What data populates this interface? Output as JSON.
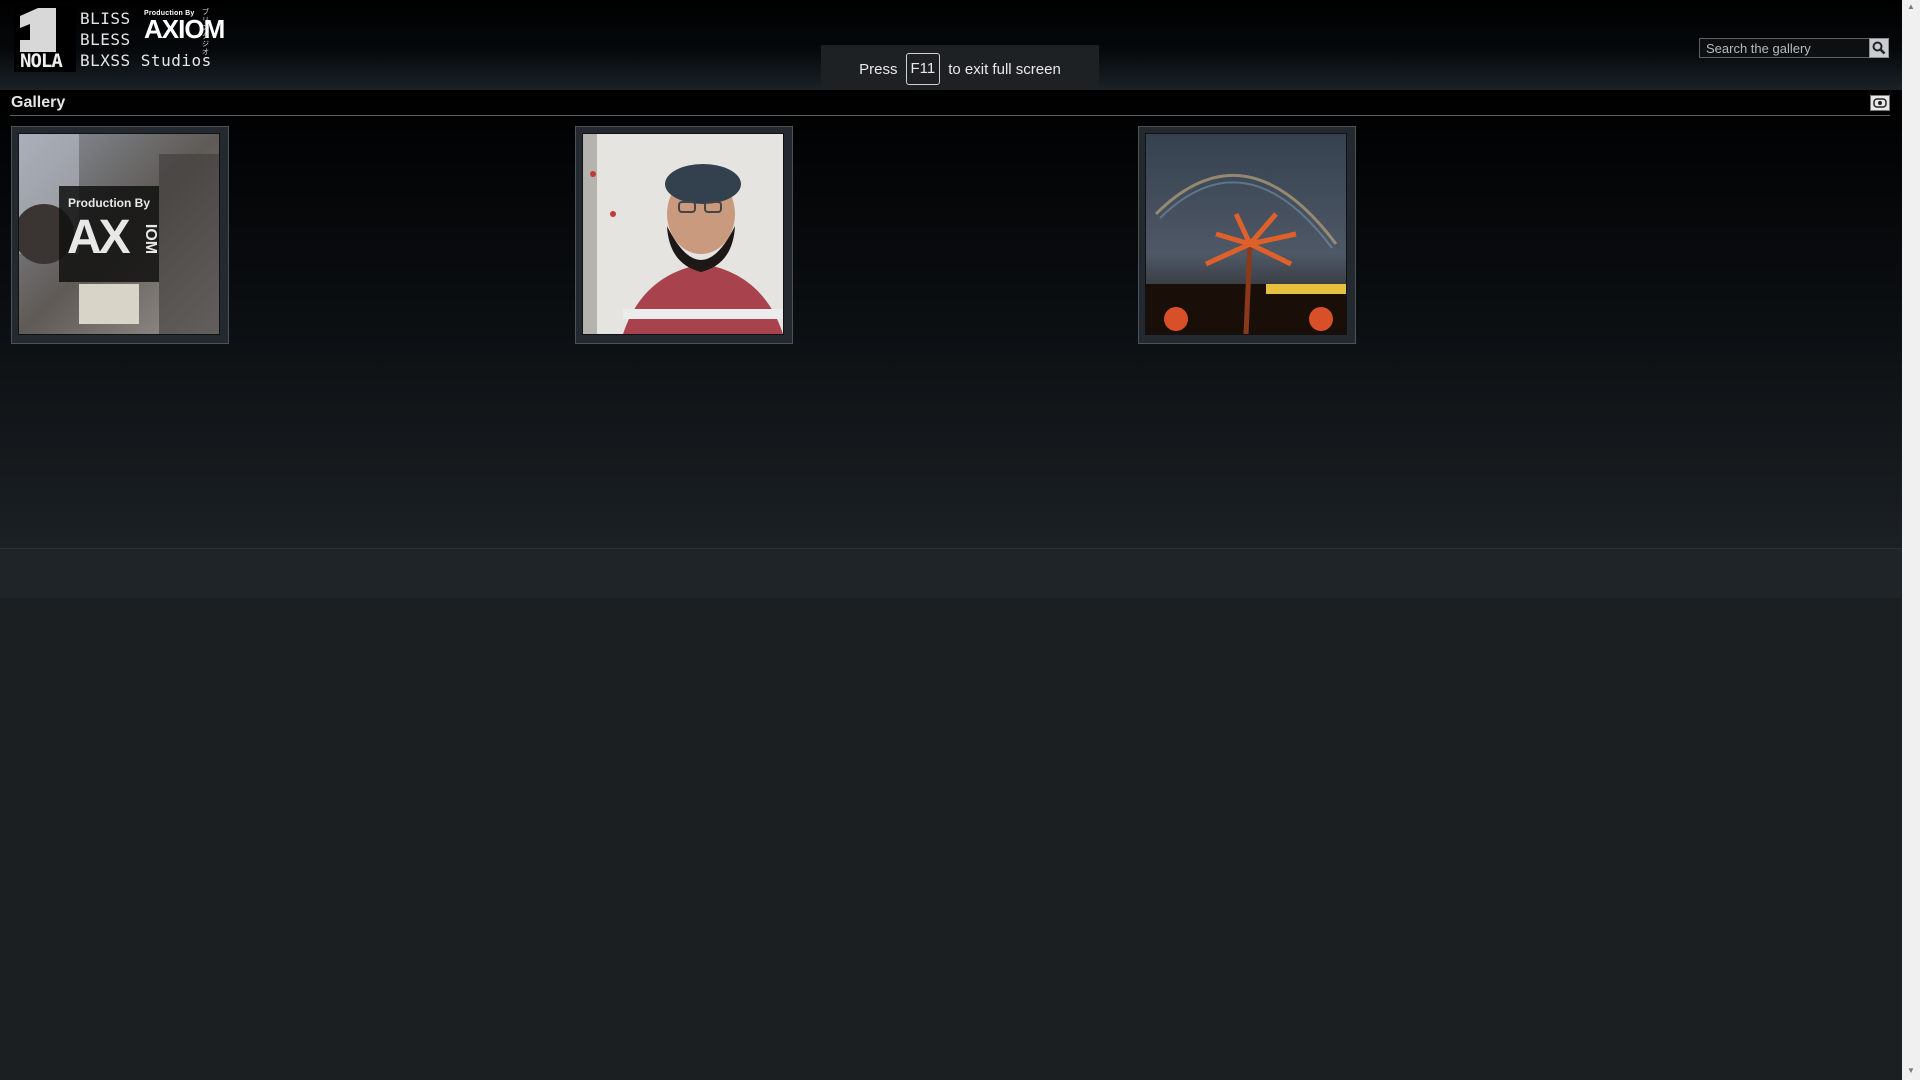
{
  "header": {
    "logo": {
      "numeral": "1",
      "city": "NOLA",
      "line1": "BLISS",
      "line2": "BLESS",
      "line3": "BLXSS Studios",
      "badge_small": "Production By",
      "badge_big": "AXIOM",
      "kana": "ブリスタジオ"
    },
    "search": {
      "placeholder": "Search the gallery",
      "value": ""
    }
  },
  "fullscreen_toast": {
    "prefix": "Press",
    "key": "F11",
    "suffix": "to exit full screen"
  },
  "gallery": {
    "title": "Gallery",
    "thumbnails": [
      {
        "overlay_small": "Production By",
        "overlay_big": "AX",
        "overlay_side": "IOM"
      },
      {},
      {}
    ]
  },
  "colors": {
    "background": "#1b1f22",
    "header_top": "#000000",
    "text": "#e6e6e6"
  },
  "icons": [
    "search-icon",
    "slideshow-icon",
    "scroll-up-arrow-icon",
    "scroll-down-arrow-icon"
  ]
}
